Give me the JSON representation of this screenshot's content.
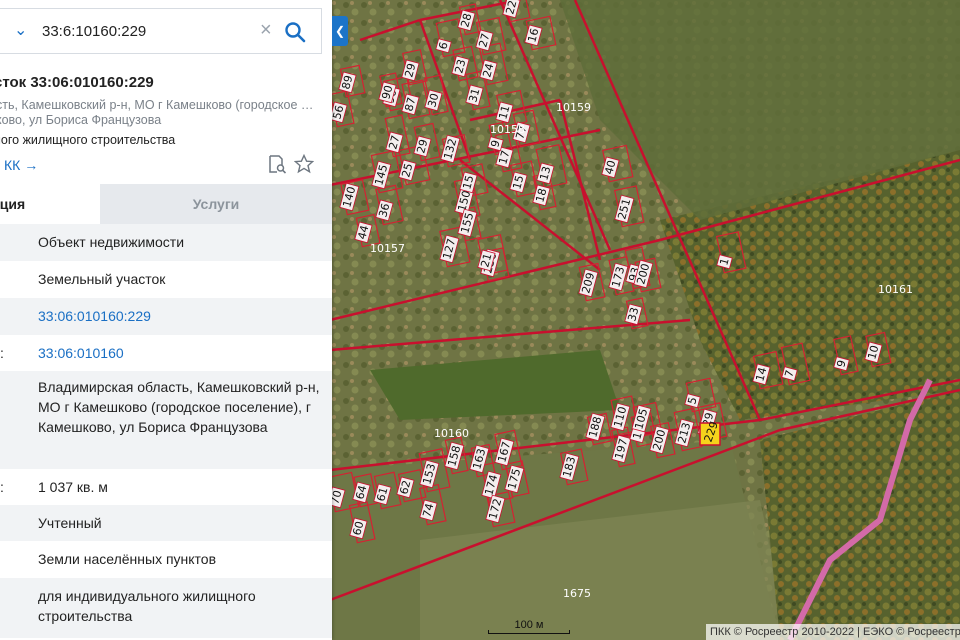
{
  "search": {
    "query": "33:6:10160:229"
  },
  "card": {
    "title": "сток 33:06:010160:229",
    "address": "сть, Камешковский р-н, МО г Камешково (городское …ково, ул Бориса Французова",
    "purpose": "ного жилищного строительства",
    "kk_link": "КК →"
  },
  "tabs": {
    "info": "ация",
    "services": "Услуги"
  },
  "rows": [
    {
      "label": "",
      "value": "Объект недвижимости",
      "link": false
    },
    {
      "label": "",
      "value": "Земельный участок",
      "link": false
    },
    {
      "label": "",
      "value": "33:06:010160:229",
      "link": true
    },
    {
      "label": ":",
      "value": "33:06:010160",
      "link": true
    },
    {
      "label": "",
      "value": "Владимирская область, Камешковский р-н, МО г Камешково (городское поселение), г Камешково, ул Бориса Французова",
      "link": false
    },
    {
      "label": ":",
      "value": "1 037 кв. м",
      "link": false
    },
    {
      "label": "",
      "value": "Учтенный",
      "link": false
    },
    {
      "label": "",
      "value": "Земли населённых пунктов",
      "link": false
    },
    {
      "label": "",
      "value": "для индивидуального жилищного строительства",
      "link": false
    }
  ],
  "map": {
    "quarters": [
      "10158",
      "10159",
      "10157",
      "10160",
      "10161",
      "1675"
    ],
    "plot_labels": [
      "28",
      "27",
      "24",
      "23",
      "31",
      "16",
      "6",
      "22",
      "29",
      "30",
      "90",
      "87",
      "89",
      "56",
      "145",
      "140",
      "36",
      "44",
      "18",
      "13",
      "15",
      "17",
      "9",
      "25",
      "132",
      "77",
      "150",
      "155",
      "127",
      "236",
      "209",
      "93",
      "40",
      "251",
      "200",
      "173",
      "33",
      "14",
      "7",
      "10",
      "9",
      "5",
      "229",
      "213",
      "200",
      "197",
      "105",
      "110",
      "188",
      "175",
      "174",
      "172",
      "167",
      "163",
      "158",
      "153",
      "183",
      "74",
      "64",
      "70",
      "62",
      "61",
      "60",
      "90",
      "21",
      "15",
      "29",
      "27",
      "11",
      "1",
      "1"
    ],
    "selected_plot": "229",
    "scale_label": "100 м",
    "attribution": "ПКК © Росреестр 2010-2022 | ЕЭКО © Росреестр"
  },
  "colors": {
    "accent": "#1a6fc4",
    "boundary": "#c8102e",
    "selected_fill": "#f5d31c"
  },
  "icons": {
    "collapse": "chevron-left-icon",
    "dropdown": "chevron-down-icon",
    "search": "search-icon",
    "clear": "close-icon",
    "doc": "document-search-icon",
    "star": "star-icon"
  }
}
